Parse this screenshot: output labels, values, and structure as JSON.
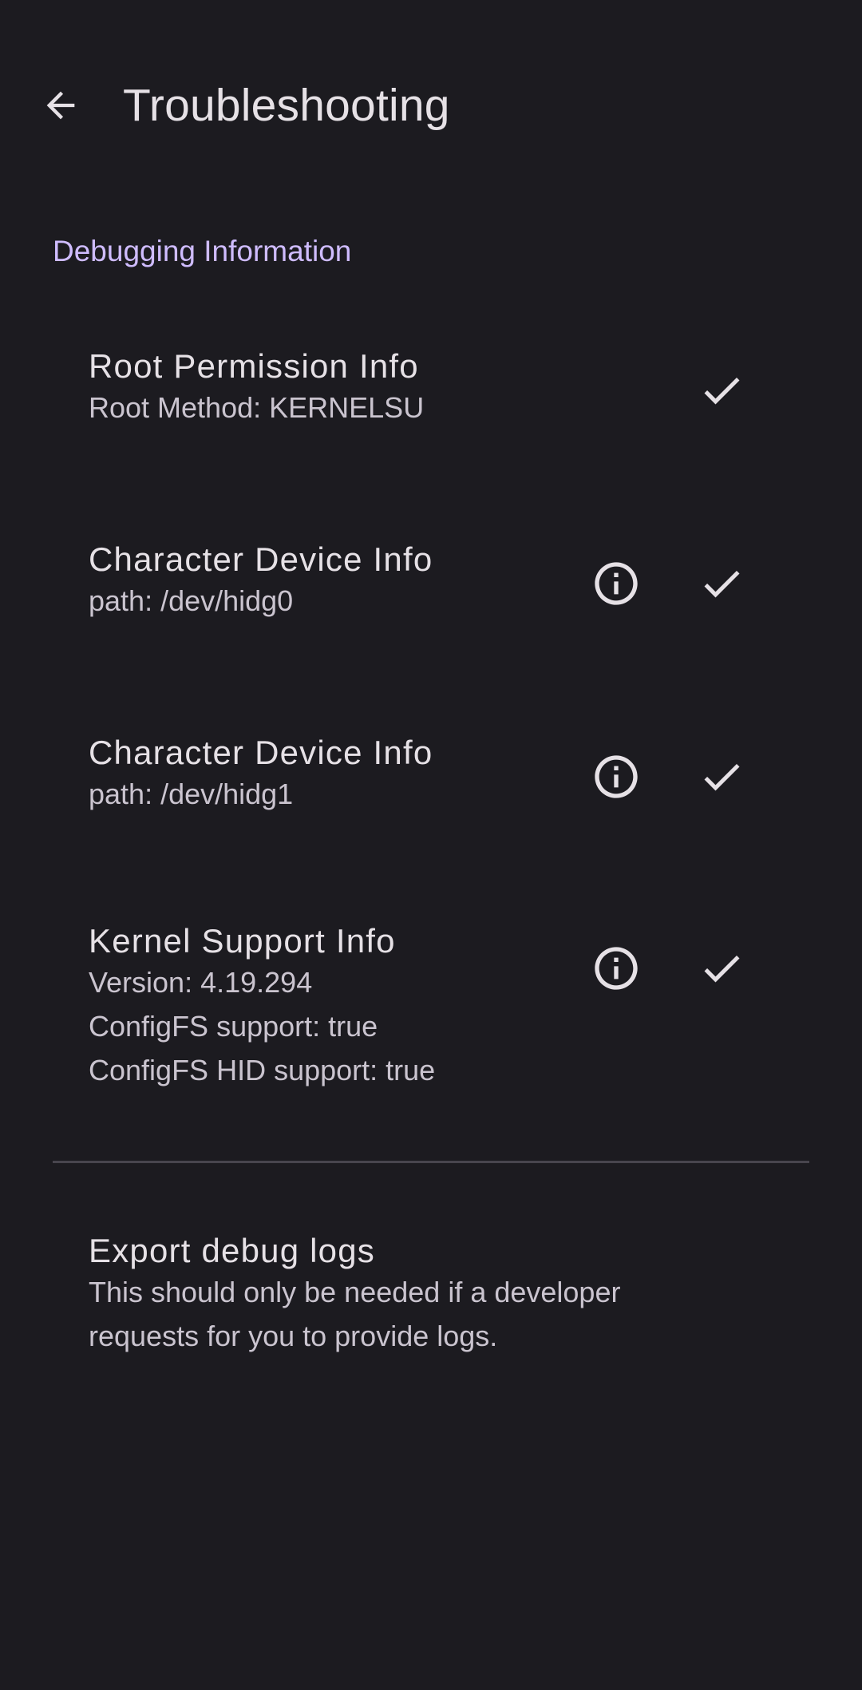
{
  "app_bar": {
    "title": "Troubleshooting",
    "back_icon": "arrow-back-icon"
  },
  "section": {
    "header": "Debugging Information"
  },
  "items": [
    {
      "title": "Root Permission Info",
      "lines": [
        "Root Method: KERNELSU"
      ],
      "info_icon": false,
      "status_icon": "check-icon"
    },
    {
      "title": "Character Device Info",
      "lines": [
        "path: /dev/hidg0"
      ],
      "info_icon": true,
      "status_icon": "check-icon"
    },
    {
      "title": "Character Device Info",
      "lines": [
        "path: /dev/hidg1"
      ],
      "info_icon": true,
      "status_icon": "check-icon"
    },
    {
      "title": "Kernel Support Info",
      "lines": [
        "Version: 4.19.294",
        "ConfigFS support: true",
        "ConfigFS HID support: true"
      ],
      "info_icon": true,
      "status_icon": "check-icon"
    }
  ],
  "export": {
    "title": "Export debug logs",
    "lines": [
      "This should only be needed if a developer",
      "requests for you to provide logs."
    ]
  },
  "colors": {
    "background": "#1c1b20",
    "accent": "#cfbcff",
    "text_primary": "#e6e1e6",
    "text_secondary": "#cac4cf"
  }
}
